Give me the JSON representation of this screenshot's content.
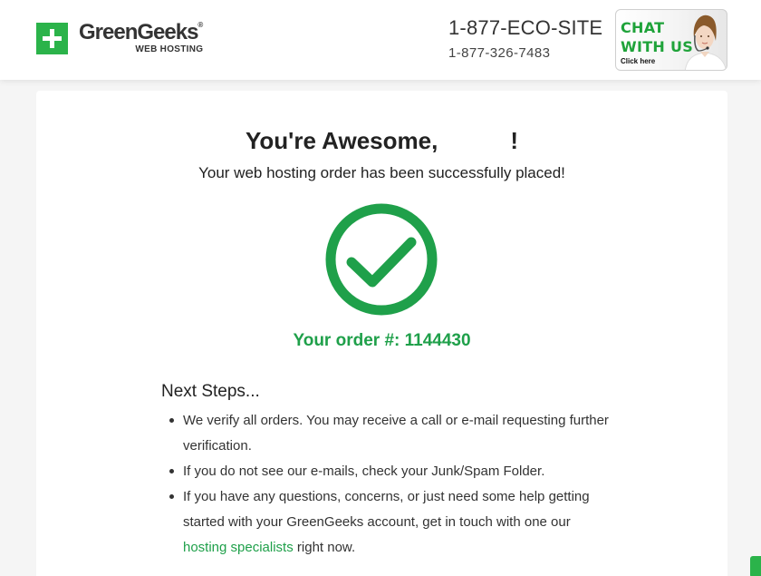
{
  "header": {
    "logo_name": "GreenGeeks",
    "logo_reg": "®",
    "logo_sub": "WEB HOSTING",
    "phone_main": "1-877-ECO-SITE",
    "phone_sub": "1-877-326-7483",
    "chat_line1": "CHAT",
    "chat_line2": "WITH US",
    "chat_click": "Click here"
  },
  "main": {
    "title_prefix": "You're Awesome,",
    "title_suffix": "!",
    "subtitle": "Your web hosting order has been successfully placed!",
    "order_label": "Your order #: 1144430",
    "next_steps_title": "Next Steps...",
    "steps": [
      "We verify all orders. You may receive a call or e-mail requesting further verification.",
      "If you do not see our e-mails, check your Junk/Spam Folder."
    ],
    "step3_before": "If you have any questions, concerns, or just need some help getting started with your GreenGeeks account, get in touch with one our ",
    "step3_link": "hosting specialists",
    "step3_after": " right now."
  },
  "colors": {
    "brand_green": "#2bb34a",
    "order_green": "#1fa04a"
  },
  "icons": {
    "logo": "plus-icon",
    "success": "checkmark-circle-icon",
    "chat_agent": "support-agent-icon"
  }
}
